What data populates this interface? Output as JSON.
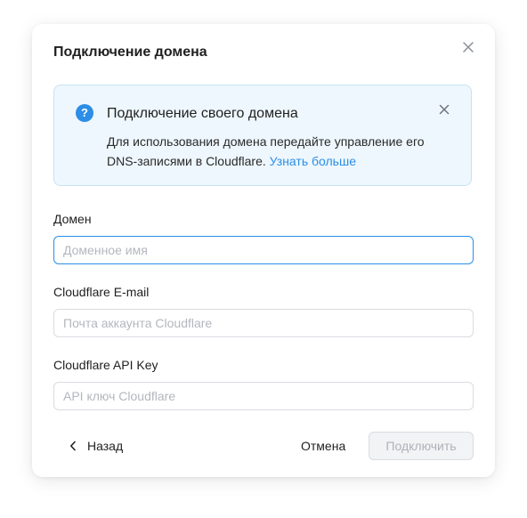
{
  "modal": {
    "title": "Подключение домена"
  },
  "info": {
    "title": "Подключение своего домена",
    "text": "Для использования домена передайте управление его DNS-записями в Cloudflare.",
    "link": "Узнать больше"
  },
  "fields": {
    "domain": {
      "label": "Домен",
      "placeholder": "Доменное имя",
      "value": ""
    },
    "email": {
      "label": "Cloudflare E-mail",
      "placeholder": "Почта аккаунта Cloudflare",
      "value": ""
    },
    "apikey": {
      "label": "Cloudflare API Key",
      "placeholder": "API ключ Cloudflare",
      "value": ""
    }
  },
  "footer": {
    "back_label": "Назад",
    "cancel_label": "Отмена",
    "connect_label": "Подключить"
  },
  "colors": {
    "accent": "#2c8ee6",
    "info_bg": "#eef7fd",
    "info_border": "#c6e3f3",
    "disabled_bg": "#f2f3f5",
    "disabled_text": "#aeb2b8"
  },
  "icons": {
    "modal_close": "close-icon",
    "info": "question-circle-icon",
    "info_close": "close-icon",
    "back": "chevron-left-icon"
  }
}
